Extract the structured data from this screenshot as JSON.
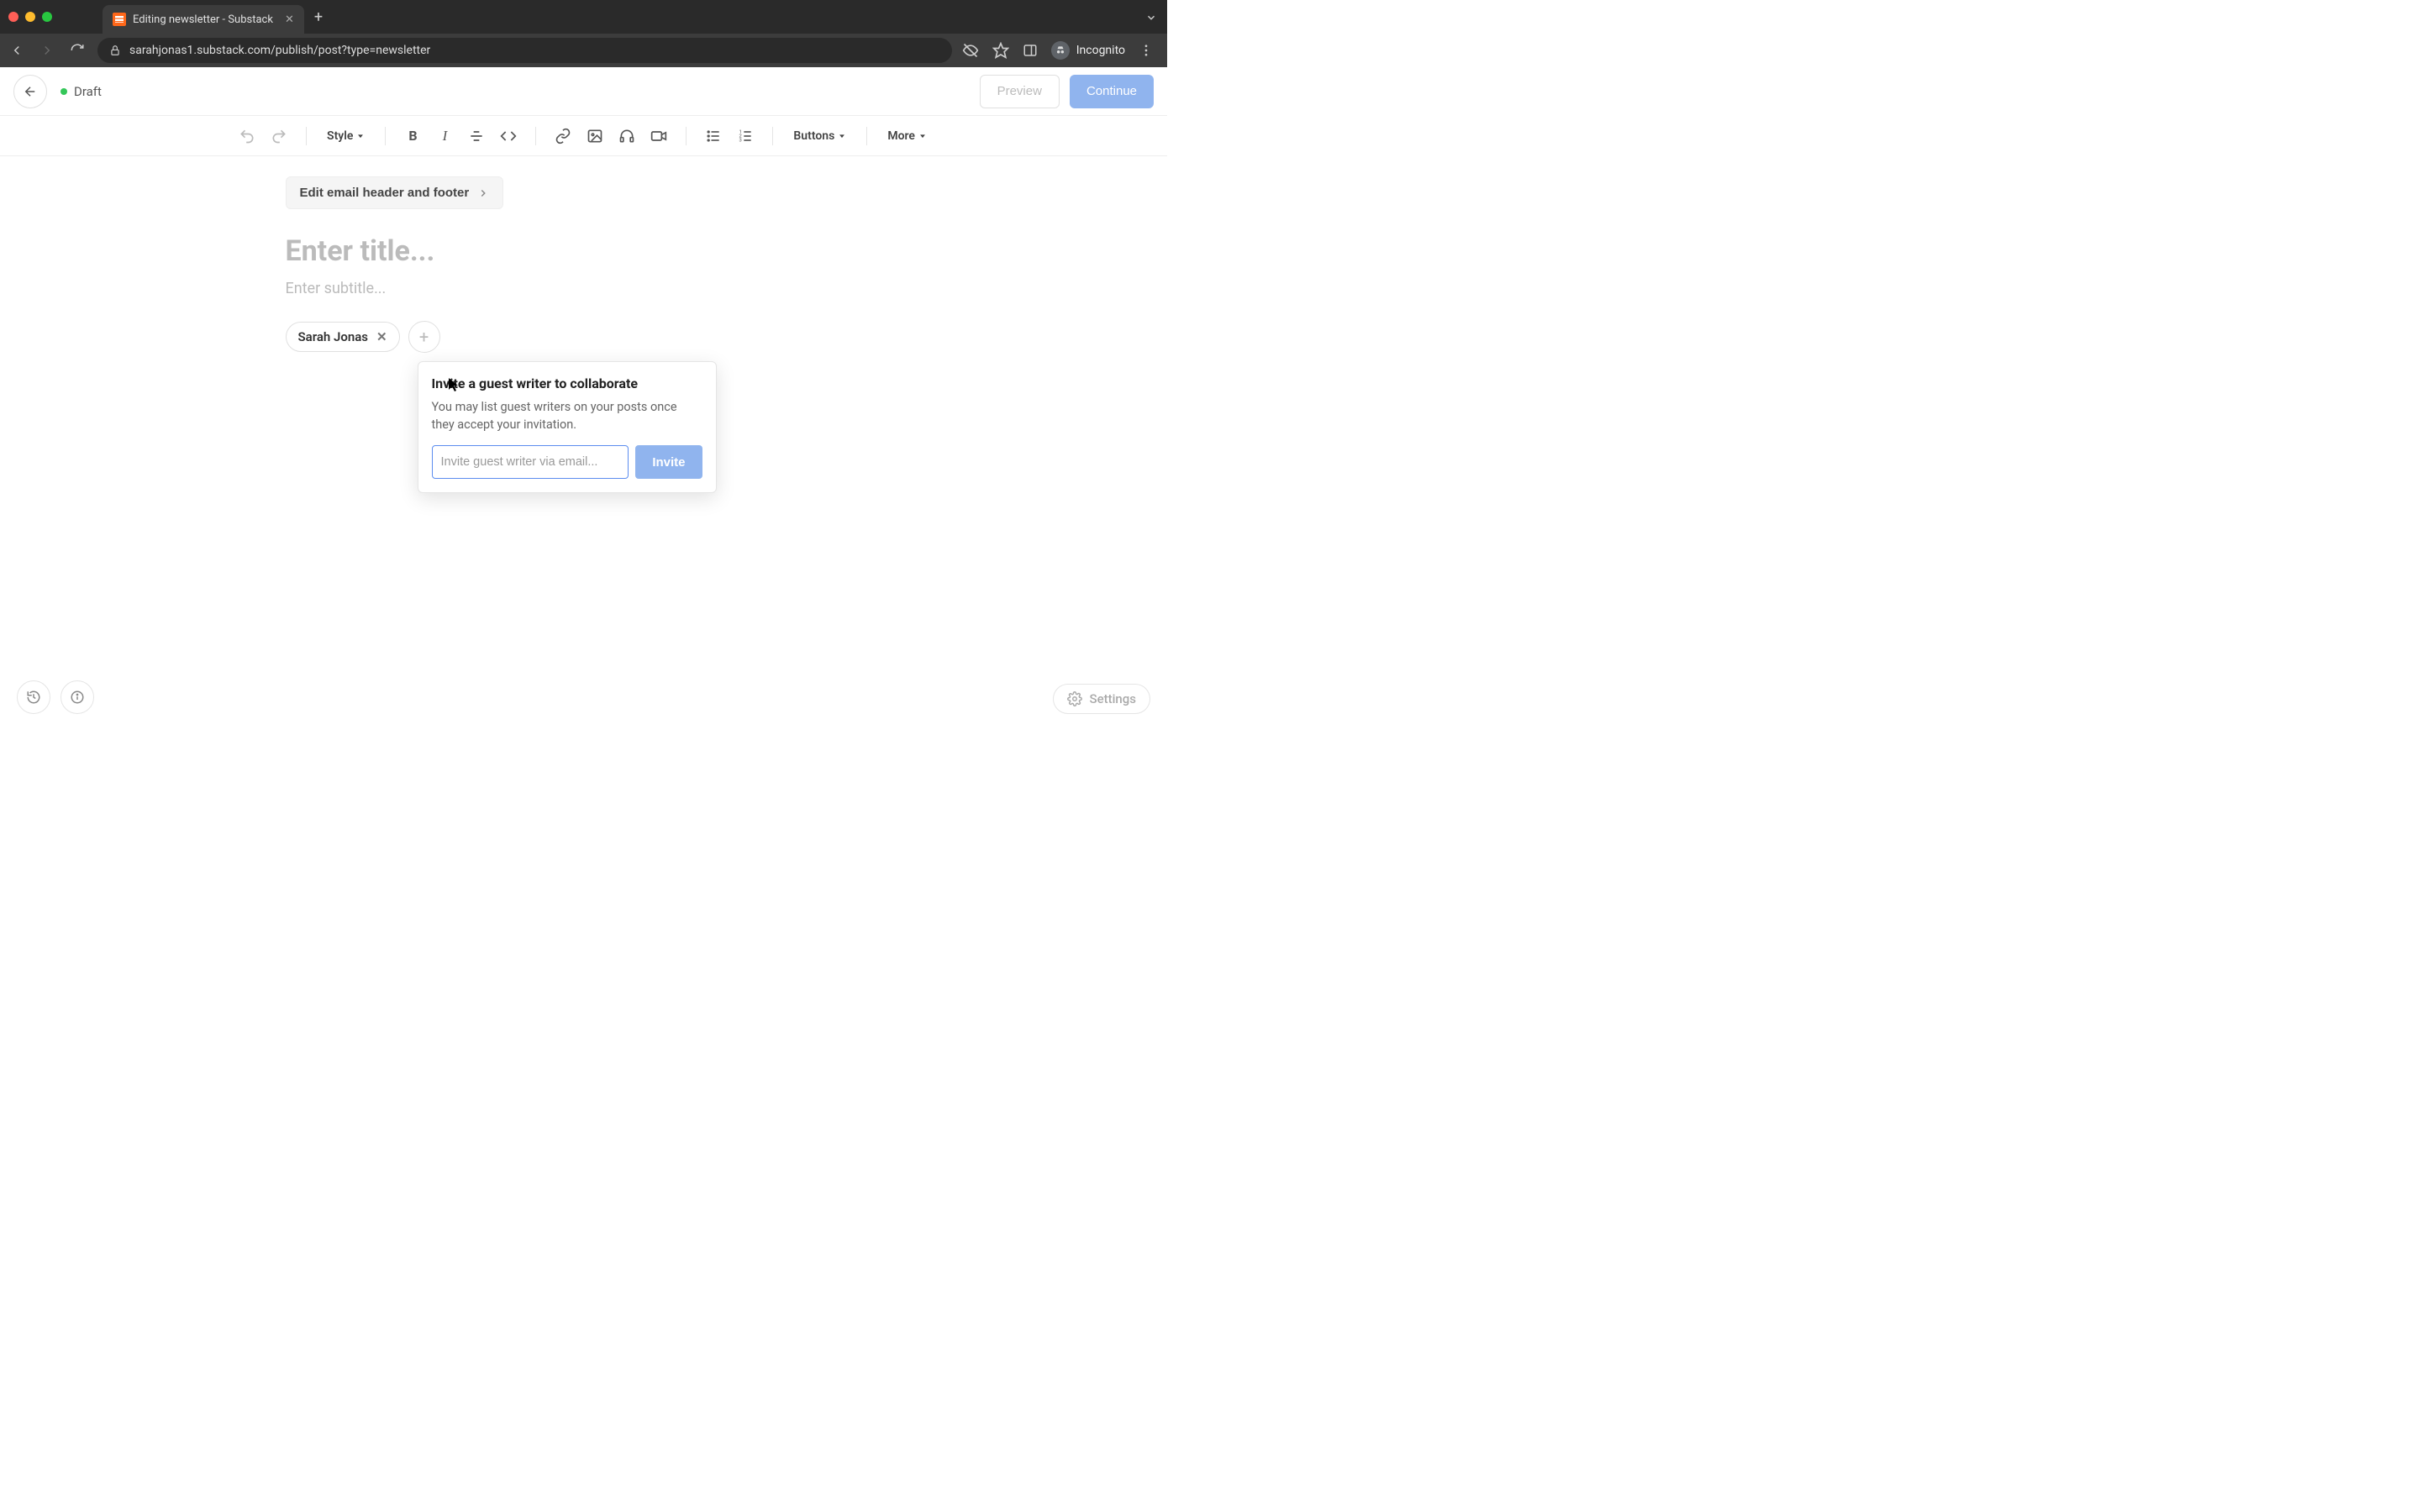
{
  "browser": {
    "tab_title": "Editing newsletter - Substack",
    "url": "sarahjonas1.substack.com/publish/post?type=newsletter",
    "incognito_label": "Incognito"
  },
  "header": {
    "status_label": "Draft",
    "preview_label": "Preview",
    "continue_label": "Continue"
  },
  "toolbar": {
    "style_label": "Style",
    "buttons_label": "Buttons",
    "more_label": "More"
  },
  "editor": {
    "email_header_button": "Edit email header and footer",
    "title_placeholder": "Enter title...",
    "subtitle_placeholder": "Enter subtitle...",
    "author_name": "Sarah Jonas"
  },
  "popover": {
    "title": "Invite a guest writer to collaborate",
    "description": "You may list guest writers on your posts once they accept your invitation.",
    "email_placeholder": "Invite guest writer via email...",
    "invite_label": "Invite"
  },
  "footer": {
    "settings_label": "Settings"
  }
}
